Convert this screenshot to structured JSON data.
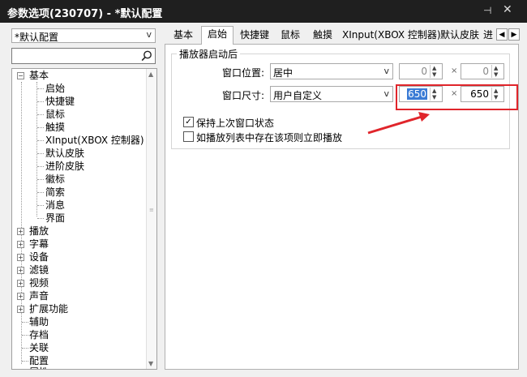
{
  "window": {
    "title": "参数选项(230707) - *默认配置",
    "pin_icon": "pin-icon",
    "close_icon": "close-icon"
  },
  "left": {
    "profile": "*默认配置",
    "search": {
      "placeholder": ""
    },
    "tree": {
      "basic": "基本",
      "basic_children": [
        "启始",
        "快捷键",
        "鼠标",
        "触摸",
        "XInput(XBOX 控制器)",
        "默认皮肤",
        "进阶皮肤",
        "徽标",
        "简索",
        "消息",
        "界面"
      ],
      "roots": [
        "播放",
        "字幕",
        "设备",
        "滤镜",
        "视频",
        "声音",
        "扩展功能"
      ],
      "leaves": [
        "辅助",
        "存档",
        "关联",
        "配置",
        "属性"
      ]
    }
  },
  "tabs": [
    "基本",
    "启始",
    "快捷键",
    "鼠标",
    "触摸",
    "XInput(XBOX 控制器)",
    "默认皮肤",
    "进"
  ],
  "active_tab": "启始",
  "group": {
    "title": "播放器启动后",
    "position_label": "窗口位置:",
    "position_value": "居中",
    "position_x": "0",
    "position_y": "0",
    "size_label": "窗口尺寸:",
    "size_value": "用户自定义",
    "size_w": "650",
    "size_h": "650",
    "times": "×"
  },
  "checks": [
    {
      "label": "保持上次窗口状态",
      "checked": true
    },
    {
      "label": "如播放列表中存在该项则立即播放",
      "checked": false
    }
  ],
  "colors": {
    "titlebar": "#1f1f1f",
    "highlight": "#e0252b",
    "selection": "#3a7bd5"
  }
}
